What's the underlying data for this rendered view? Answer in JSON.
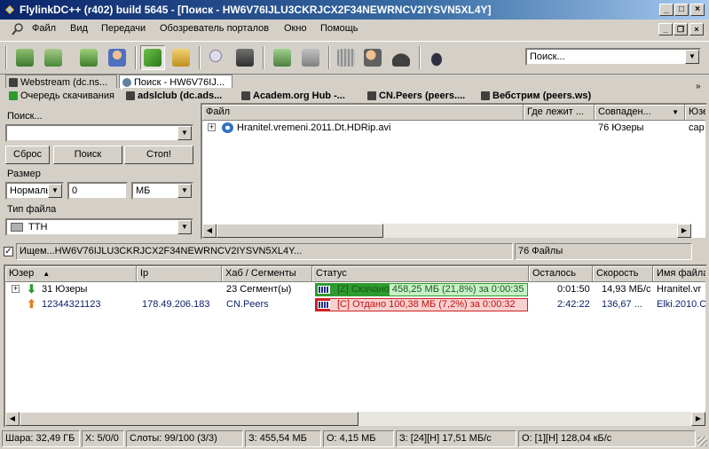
{
  "window": {
    "title": "FlylinkDC++ (r402) build 5645 - [Поиск - HW6V76IJLU3CKRJCX2F34NEWRNCV2IYSVN5XL4Y]",
    "controls": [
      "_",
      "□",
      "×"
    ]
  },
  "menu": {
    "items": [
      "Файл",
      "Вид",
      "Передачи",
      "Обозреватель порталов",
      "Окно",
      "Помощь"
    ]
  },
  "toolbar": {
    "quick_search_placeholder": "Поиск..."
  },
  "tabs_row1": [
    "Webstream (dc.ns...",
    "Поиск - HW6V76IJ..."
  ],
  "tabs_row2": [
    "Очередь скачивания",
    "adslclub (dc.ads...",
    "Academ.org Hub -...",
    "CN.Peers (peers....",
    "Вебстрим (peers.ws)"
  ],
  "search_panel": {
    "search_label": "Поиск...",
    "search_value": "",
    "reset_button": "Сброс",
    "search_button": "Поиск",
    "stop_button": "Стоп!",
    "size_label": "Размер",
    "size_mode": "Нормаль",
    "size_value": "0",
    "size_unit": "МБ",
    "filetype_label": "Тип файла",
    "filetype_value": "TTH"
  },
  "results": {
    "columns": [
      "Файл",
      "Где лежит ...",
      "Совпаден...",
      "Юзе"
    ],
    "rows": [
      {
        "file": "Hranitel.vremeni.2011.Dt.HDRip.avi",
        "where": "",
        "matches": "76 Юзеры",
        "user": "сар"
      }
    ]
  },
  "search_status": {
    "checked": true,
    "text": "Ищем...HW6V76IJLU3CKRJCX2F34NEWRNCV2IYSVN5XL4Y...",
    "files": "76 Файлы"
  },
  "transfers": {
    "columns": [
      "Юзер",
      "Ip",
      "Хаб / Сегменты",
      "Статус",
      "Осталось",
      "Скорость",
      "Имя файла"
    ],
    "rows": [
      {
        "user": "31 Юзеры",
        "ip": "",
        "hub": "23 Сегмент(ы)",
        "status": "[Z] Скачано 458,25 МБ (21,8%) за 0:00:35",
        "progress": 0.218,
        "remaining": "0:01:50",
        "speed": "14,93 МБ/с",
        "filename": "Hranitel.vr",
        "kind": "download"
      },
      {
        "user": "12344321123",
        "ip": "178.49.206.183",
        "hub": "CN.Peers",
        "status": "[C] Отдано 100,38 МБ (7,2%) за 0:00:32",
        "progress": 0.072,
        "remaining": "2:42:22",
        "speed": "136,67 ...",
        "filename": "Elki.2010.C",
        "kind": "upload"
      }
    ]
  },
  "statusbar": {
    "share": "Шара: 32,49 ГБ",
    "slots_x": "X: 5/0/0",
    "slots": "Слоты: 99/100 (3/3)",
    "downloaded": "З: 455,54 МБ",
    "uploaded": "О: 4,15 МБ",
    "dl_speed": "З: [24][Н] 17,51 МБ/с",
    "ul_speed": "О: [1][Н] 128,04 кБ/с"
  },
  "colors": {
    "download_bar": "#2e9b2e",
    "download_bg": "#c8f0c8",
    "upload_bar": "#d02020",
    "upload_bg": "#f8d0d0",
    "selection": "#0a246a"
  }
}
